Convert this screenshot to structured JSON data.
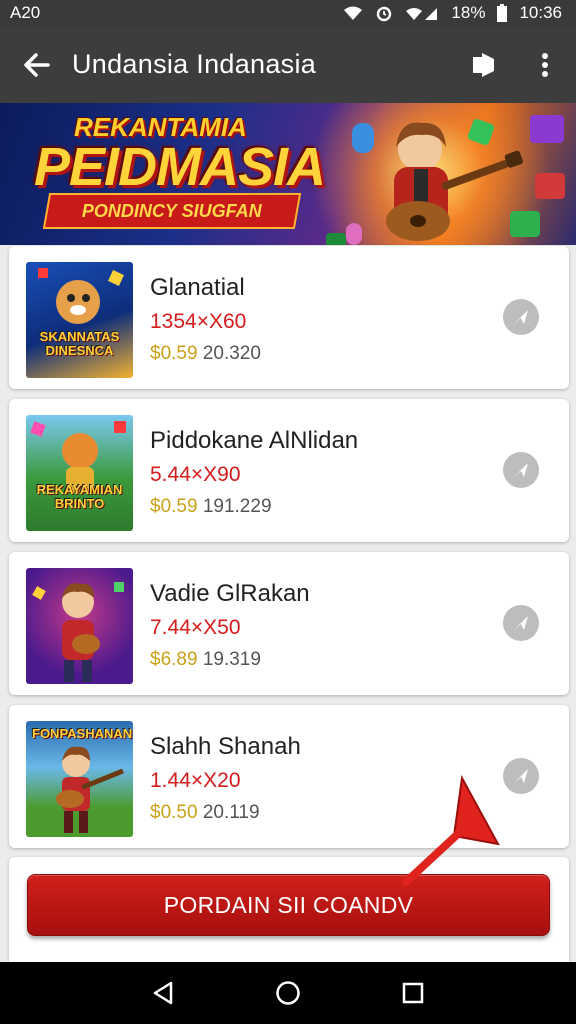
{
  "status_bar": {
    "left_text": "A20",
    "battery_text": "18%",
    "time": "10:36",
    "icons": [
      "wifi-icon",
      "alarm-icon",
      "signal-icon",
      "battery-icon"
    ]
  },
  "app_bar": {
    "title": "Undansia Indanasia",
    "icons": [
      "back-arrow-icon",
      "share-icon",
      "more-vert-icon"
    ]
  },
  "banner": {
    "line1": "REKANTAMIA",
    "line2": "PEIDMASIA",
    "ribbon": "PONDINCY SIUGFAN"
  },
  "games": [
    {
      "name": "Glanatial",
      "size": "1354×X60",
      "price": "$0.59",
      "count": "20.320",
      "thumb_label": "SKANNATAS DINESNCA",
      "thumb_colors": [
        "#1a4fb8",
        "#f2b233"
      ]
    },
    {
      "name": "Piddokane AlNlidan",
      "size": "5.44×X90",
      "price": "$0.59",
      "count": "191.229",
      "thumb_label": "REKAYAMIAN BRINTO",
      "thumb_colors": [
        "#2e8a2e",
        "#e8b030"
      ]
    },
    {
      "name": "Vadie GlRakan",
      "size": "7.44×X50",
      "price": "$6.89",
      "count": "19.319",
      "thumb_label": "",
      "thumb_colors": [
        "#4b1a8c",
        "#c23a8a"
      ]
    },
    {
      "name": "Slahh Shanah",
      "size": "1.44×X20",
      "price": "$0.50",
      "count": "20.119",
      "thumb_label": "FONPASHANAN",
      "thumb_colors": [
        "#2a6bb0",
        "#4d9a2e"
      ]
    }
  ],
  "cta": {
    "label": "PORDAIN SII COANDV"
  },
  "nav": {
    "icons": [
      "back-triangle-icon",
      "home-circle-icon",
      "recents-square-icon"
    ]
  },
  "colors": {
    "accent_red": "#c91a1a",
    "size_red": "#d41c1c",
    "price_gold": "#c9a21a",
    "app_bar": "#3d3d3d"
  }
}
